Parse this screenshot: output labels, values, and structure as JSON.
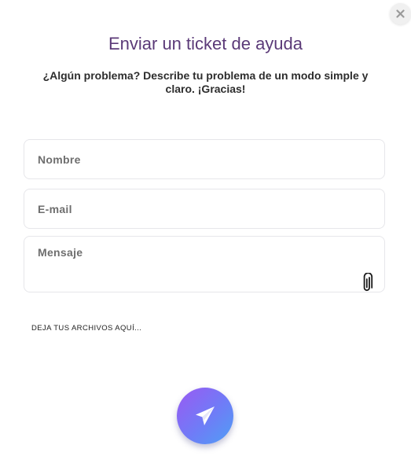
{
  "modal": {
    "title": "Enviar un ticket de ayuda",
    "subtitle": "¿Algún problema? Describe tu problema de un modo simple y claro. ¡Gracias!",
    "close_icon": "close-icon"
  },
  "form": {
    "name_placeholder": "Nombre",
    "email_placeholder": "E-mail",
    "message_placeholder": "Mensaje",
    "attach_icon": "paperclip-icon",
    "dropzone_label": "DEJA TUS ARCHIVOS AQUÍ...",
    "send_icon": "paper-plane-icon"
  },
  "colors": {
    "title": "#5b3a78",
    "send_gradient_start": "#9b59f2",
    "send_gradient_end": "#4f9ff5"
  }
}
